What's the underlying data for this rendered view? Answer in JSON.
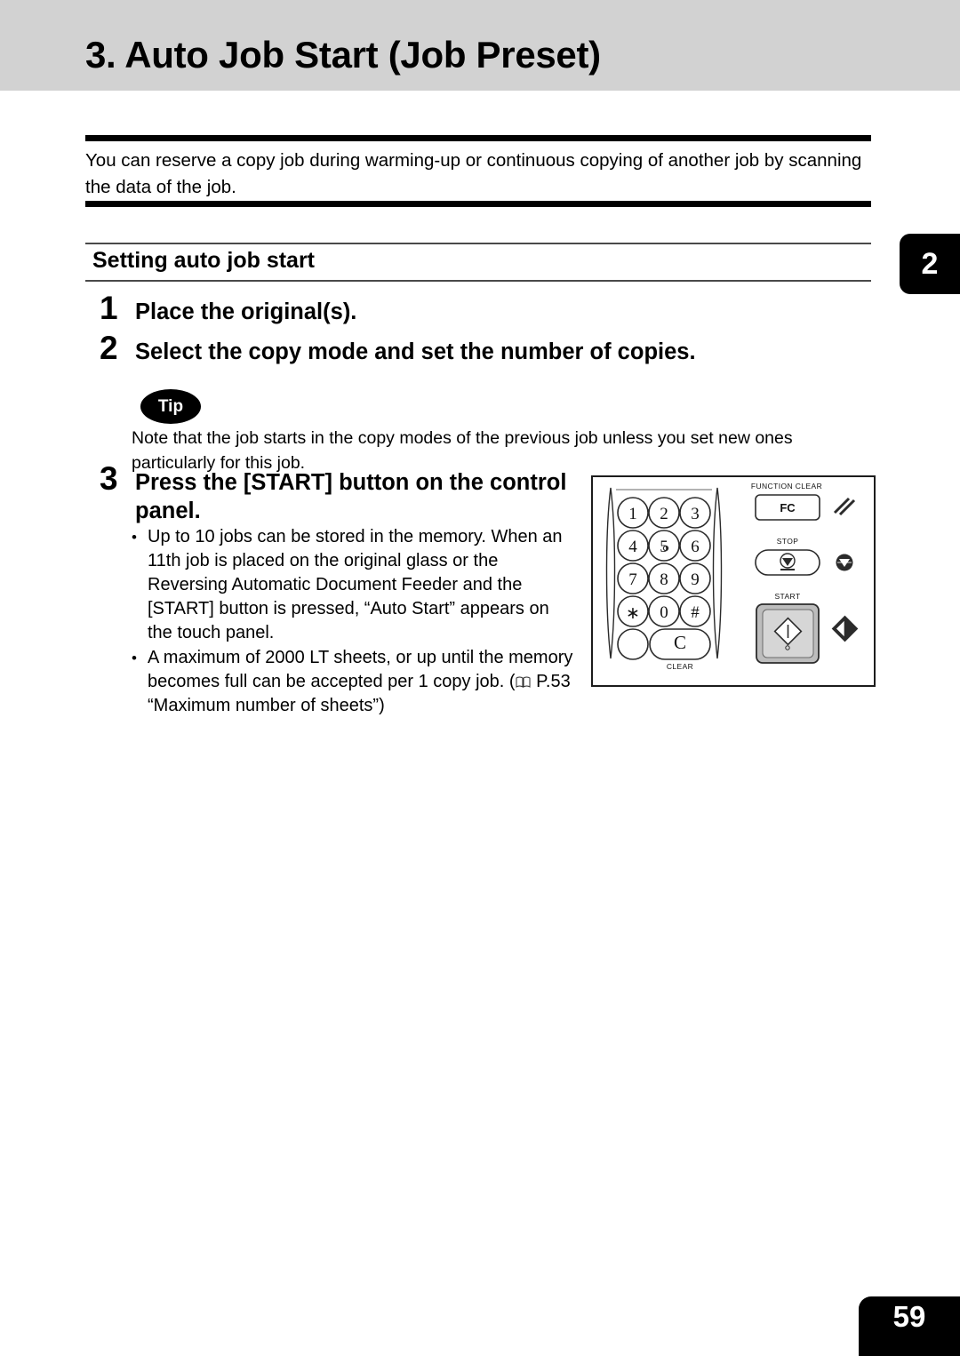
{
  "header": {
    "title": "3. Auto Job Start (Job Preset)",
    "chapter_tab": "2"
  },
  "footer": {
    "page_number": "59"
  },
  "intro": {
    "paragraph": "You can reserve a copy job during warming-up or continuous copying of another job by scanning the data of the job."
  },
  "section": {
    "heading": "Setting auto job start"
  },
  "steps": [
    {
      "number": "1",
      "text": "Place the original(s)."
    },
    {
      "number": "2",
      "text": "Select the copy mode and set the number of copies."
    },
    {
      "number": "3",
      "text": "Press the [START] button on the control panel."
    }
  ],
  "tip": {
    "badge_label": "Tip",
    "text": "Note that the job starts in the copy modes of the previous job unless you set new ones particularly for this job."
  },
  "bullets": [
    {
      "marker": "•",
      "text": "Up to 10 jobs can be stored in the memory. When an 11th job is placed on the original glass or the Reversing Automatic Document Feeder and the [START] button is pressed, “Auto Start” appears on the touch panel."
    },
    {
      "marker": "•",
      "text_before_icon": "A maximum of 2000 LT sheets, or up until the memory becomes full can be accepted per 1 copy job. (",
      "icon": "book-icon",
      "text_after_icon": " P.53 “Maximum number of sheets”)"
    }
  ],
  "control_panel": {
    "keypad": [
      [
        "1",
        "2",
        "3"
      ],
      [
        "4",
        "5",
        "6"
      ],
      [
        "7",
        "8",
        "9"
      ],
      [
        "∗",
        "0",
        "#"
      ]
    ],
    "clear_key_label": "C",
    "clear_caption": "CLEAR",
    "buttons": [
      {
        "caption": "FUNCTION CLEAR",
        "label": "FC",
        "indicator": "double-slash-icon"
      },
      {
        "caption": "STOP",
        "label": "",
        "indicator": "stop-triangle-icon"
      },
      {
        "caption": "START",
        "label": "",
        "indicator": "start-diamond-icon"
      }
    ]
  },
  "colors": {
    "header_band": "#d2d2d2",
    "tab_black": "#000000",
    "rule_black": "#000000",
    "rule_gray": "#4a4a4a",
    "start_button_fill": "#d6d6d6"
  }
}
